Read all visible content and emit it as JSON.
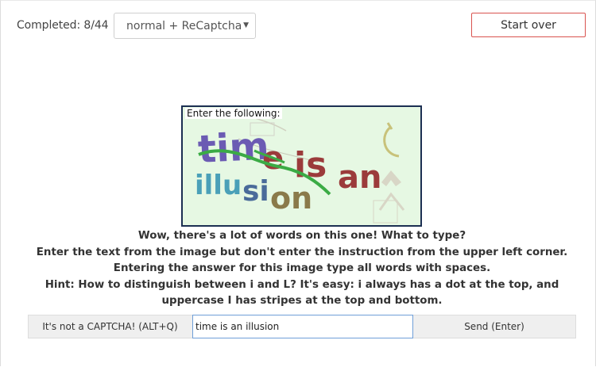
{
  "header": {
    "completed_text": "Completed: 8/44",
    "mode_select_value": "normal + ReCaptcha",
    "start_over_label": "Start over"
  },
  "captcha": {
    "label": "Enter the following:",
    "image_text_line1": "time is an",
    "image_text_line2": "illusion"
  },
  "instructions": [
    "Wow, there's a lot of words on this one! What to type?",
    "Enter the text from the image but don't enter the instruction from the upper left corner.",
    "Entering the answer for this image type all words with spaces.",
    "Hint: How to distinguish between i and L? It's easy: i always has a dot at the top, and uppercase I has stripes at the top and bottom."
  ],
  "answer": {
    "not_captcha_label": "It's not a CAPTCHA! (ALT+Q)",
    "input_value": "time is an illusion",
    "send_label": "Send (Enter)"
  },
  "colors": {
    "start_over_border": "#d9534f",
    "captcha_bg": "#e6f8e3",
    "captcha_border": "#1c2f52",
    "input_border": "#6f9fd8"
  }
}
